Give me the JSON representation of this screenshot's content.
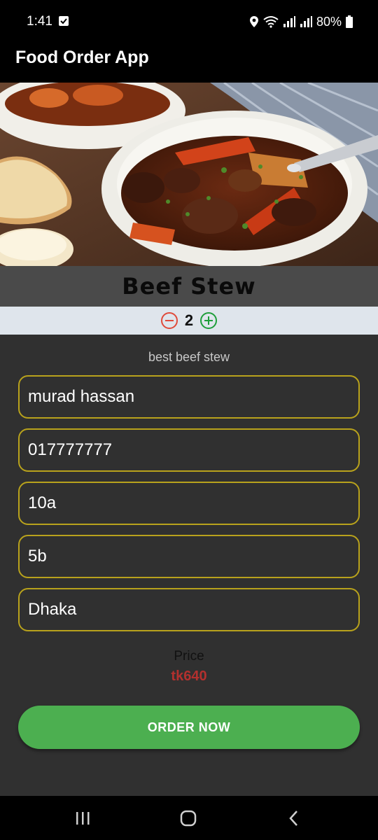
{
  "status_bar": {
    "time": "1:41",
    "battery": "80%",
    "icons": [
      "checkbox-notification-icon",
      "location-icon",
      "wifi-icon",
      "signal-icon",
      "signal-icon",
      "battery-icon"
    ]
  },
  "app_bar": {
    "title": "Food Order App"
  },
  "food": {
    "image": "beef-stew-photo",
    "name": "Beef Stew",
    "description": "best beef stew"
  },
  "quantity": {
    "value": "2",
    "decrement_icon": "minus-circle-icon",
    "increment_icon": "plus-circle-icon"
  },
  "form": {
    "name": "murad hassan",
    "phone": "017777777",
    "house": "10a",
    "road": "5b",
    "city": "Dhaka"
  },
  "price": {
    "label": "Price",
    "value": "tk640"
  },
  "order_button": {
    "label": "ORDER NOW"
  },
  "colors": {
    "background": "#303030",
    "field_border": "#b8a21c",
    "price": "#b3302e",
    "order_button": "#4caf50",
    "decrement": "#e04a3a",
    "increment": "#1e9e3a"
  },
  "nav": [
    "recents-icon",
    "home-icon",
    "back-icon"
  ]
}
